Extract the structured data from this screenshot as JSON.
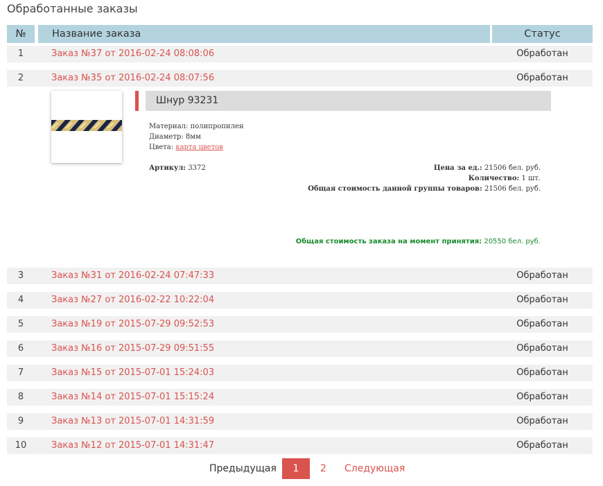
{
  "page": {
    "title": "Обработанные заказы"
  },
  "table": {
    "headers": {
      "num": "№",
      "name": "Название заказа",
      "status": "Статус"
    },
    "rows": [
      {
        "num": "1",
        "name": "Заказ №37 от 2016-02-24 08:08:06",
        "status": "Обработан"
      },
      {
        "num": "2",
        "name": "Заказ №35 от 2016-02-24 08:07:56",
        "status": "Обработан"
      },
      {
        "num": "3",
        "name": "Заказ №31 от 2016-02-24 07:47:33",
        "status": "Обработан"
      },
      {
        "num": "4",
        "name": "Заказ №27 от 2016-02-22 10:22:04",
        "status": "Обработан"
      },
      {
        "num": "5",
        "name": "Заказ №19 от 2015-07-29 09:52:53",
        "status": "Обработан"
      },
      {
        "num": "6",
        "name": "Заказ №16 от 2015-07-29 09:51:55",
        "status": "Обработан"
      },
      {
        "num": "7",
        "name": "Заказ №15 от 2015-07-01 15:24:03",
        "status": "Обработан"
      },
      {
        "num": "8",
        "name": "Заказ №14 от 2015-07-01 15:15:24",
        "status": "Обработан"
      },
      {
        "num": "9",
        "name": "Заказ №13 от 2015-07-01 14:31:59",
        "status": "Обработан"
      },
      {
        "num": "10",
        "name": "Заказ №12 от 2015-07-01 14:31:47",
        "status": "Обработан"
      }
    ]
  },
  "detail": {
    "product_title": "Шнур 93231",
    "material": "Материал: полипропилен",
    "diameter": "Диаметр: 8мм",
    "colors_label": "Цвета:",
    "colors_link": "карта цветов",
    "article_label": "Артикул:",
    "article_value": "3372",
    "unit_price_label": "Цена за ед.:",
    "unit_price_value": "21506 бел. руб.",
    "quantity_label": "Количество:",
    "quantity_value": "1 шт.",
    "group_total_label": "Общая стоимость данной группы товаров:",
    "group_total_value": "21506 бел. руб.",
    "order_total_label": "Общая стоимость заказа на момент принятия:",
    "order_total_value": "20550 бел. руб."
  },
  "pagination": {
    "prev": "Предыдущая",
    "pages": [
      "1",
      "2"
    ],
    "current": "1",
    "next": "Следующая"
  },
  "colors": {
    "accent": "#d9534f",
    "header": "#b3d4df",
    "row": "#f1f1f1",
    "total_green": "#1a8a2e"
  }
}
